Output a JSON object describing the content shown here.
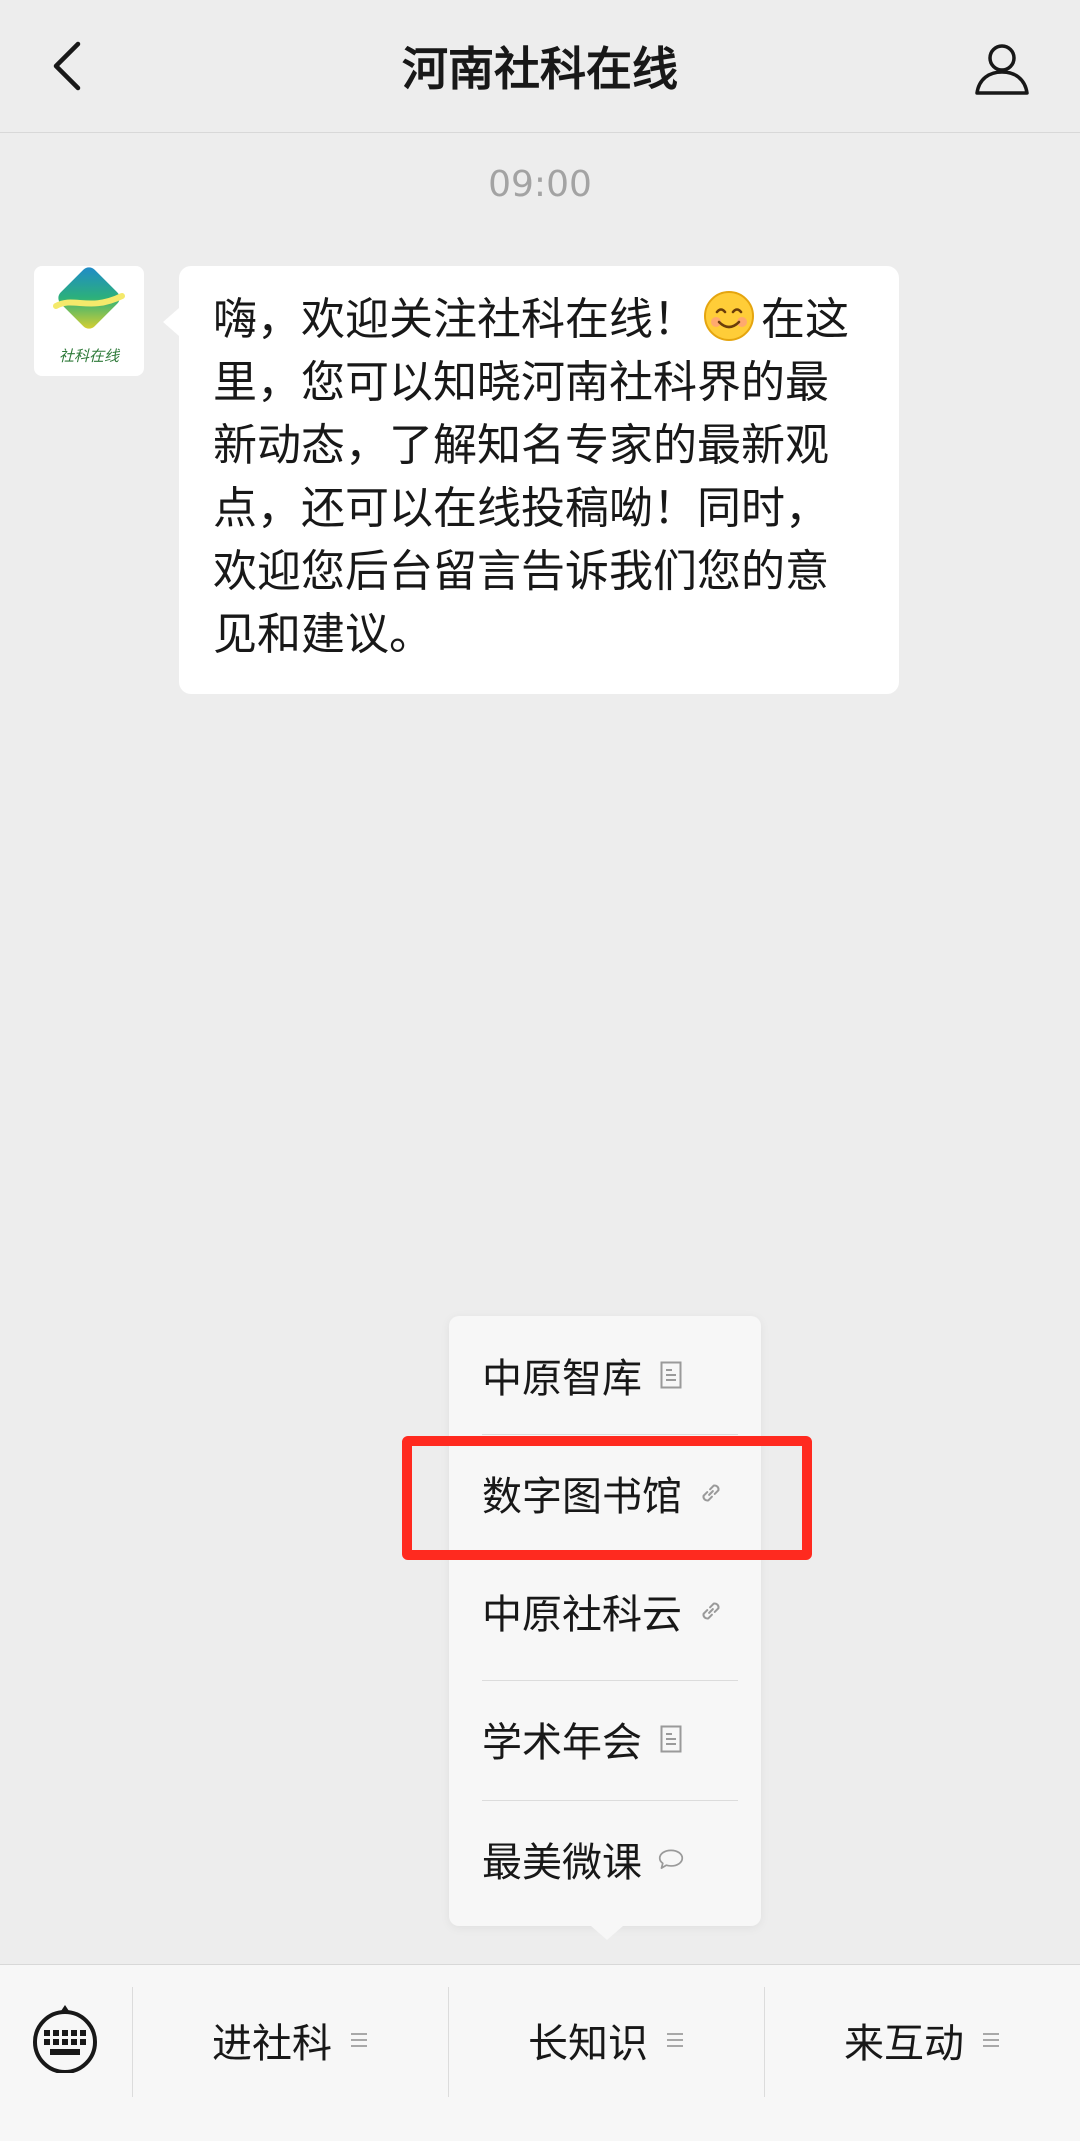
{
  "nav": {
    "title": "河南社科在线",
    "back_icon": "chevron-left-icon",
    "profile_icon": "person-icon"
  },
  "chat": {
    "timestamp": "09:00",
    "avatar_text": "社科在线",
    "message_line1": "嗨，欢迎关注社科在线！",
    "emoji": "smiling-face-icon",
    "message_line1_tail": "在这",
    "message_rest": "里，您可以知晓河南社科界的最新动态，了解知名专家的最新观点，还可以在线投稿呦！同时，欢迎您后台留言告诉我们您的意见和建议。"
  },
  "popup_menu": {
    "items": [
      {
        "label": "中原智库",
        "icon": "article-icon"
      },
      {
        "label": "数字图书馆",
        "icon": "link-icon"
      },
      {
        "label": "中原社科云",
        "icon": "link-icon"
      },
      {
        "label": "学术年会",
        "icon": "article-icon"
      },
      {
        "label": "最美微课",
        "icon": "speech-bubble-icon"
      }
    ]
  },
  "bottom_menu": {
    "keyboard_icon": "keyboard-icon",
    "tabs": [
      {
        "label": "进社科",
        "icon": "menu-lines-icon"
      },
      {
        "label": "长知识",
        "icon": "menu-lines-icon"
      },
      {
        "label": "来互动",
        "icon": "menu-lines-icon"
      }
    ]
  },
  "colors": {
    "background": "#ededed",
    "bubble": "#ffffff",
    "highlight": "#ff2a1f",
    "timestamp": "#a3a3a3"
  }
}
